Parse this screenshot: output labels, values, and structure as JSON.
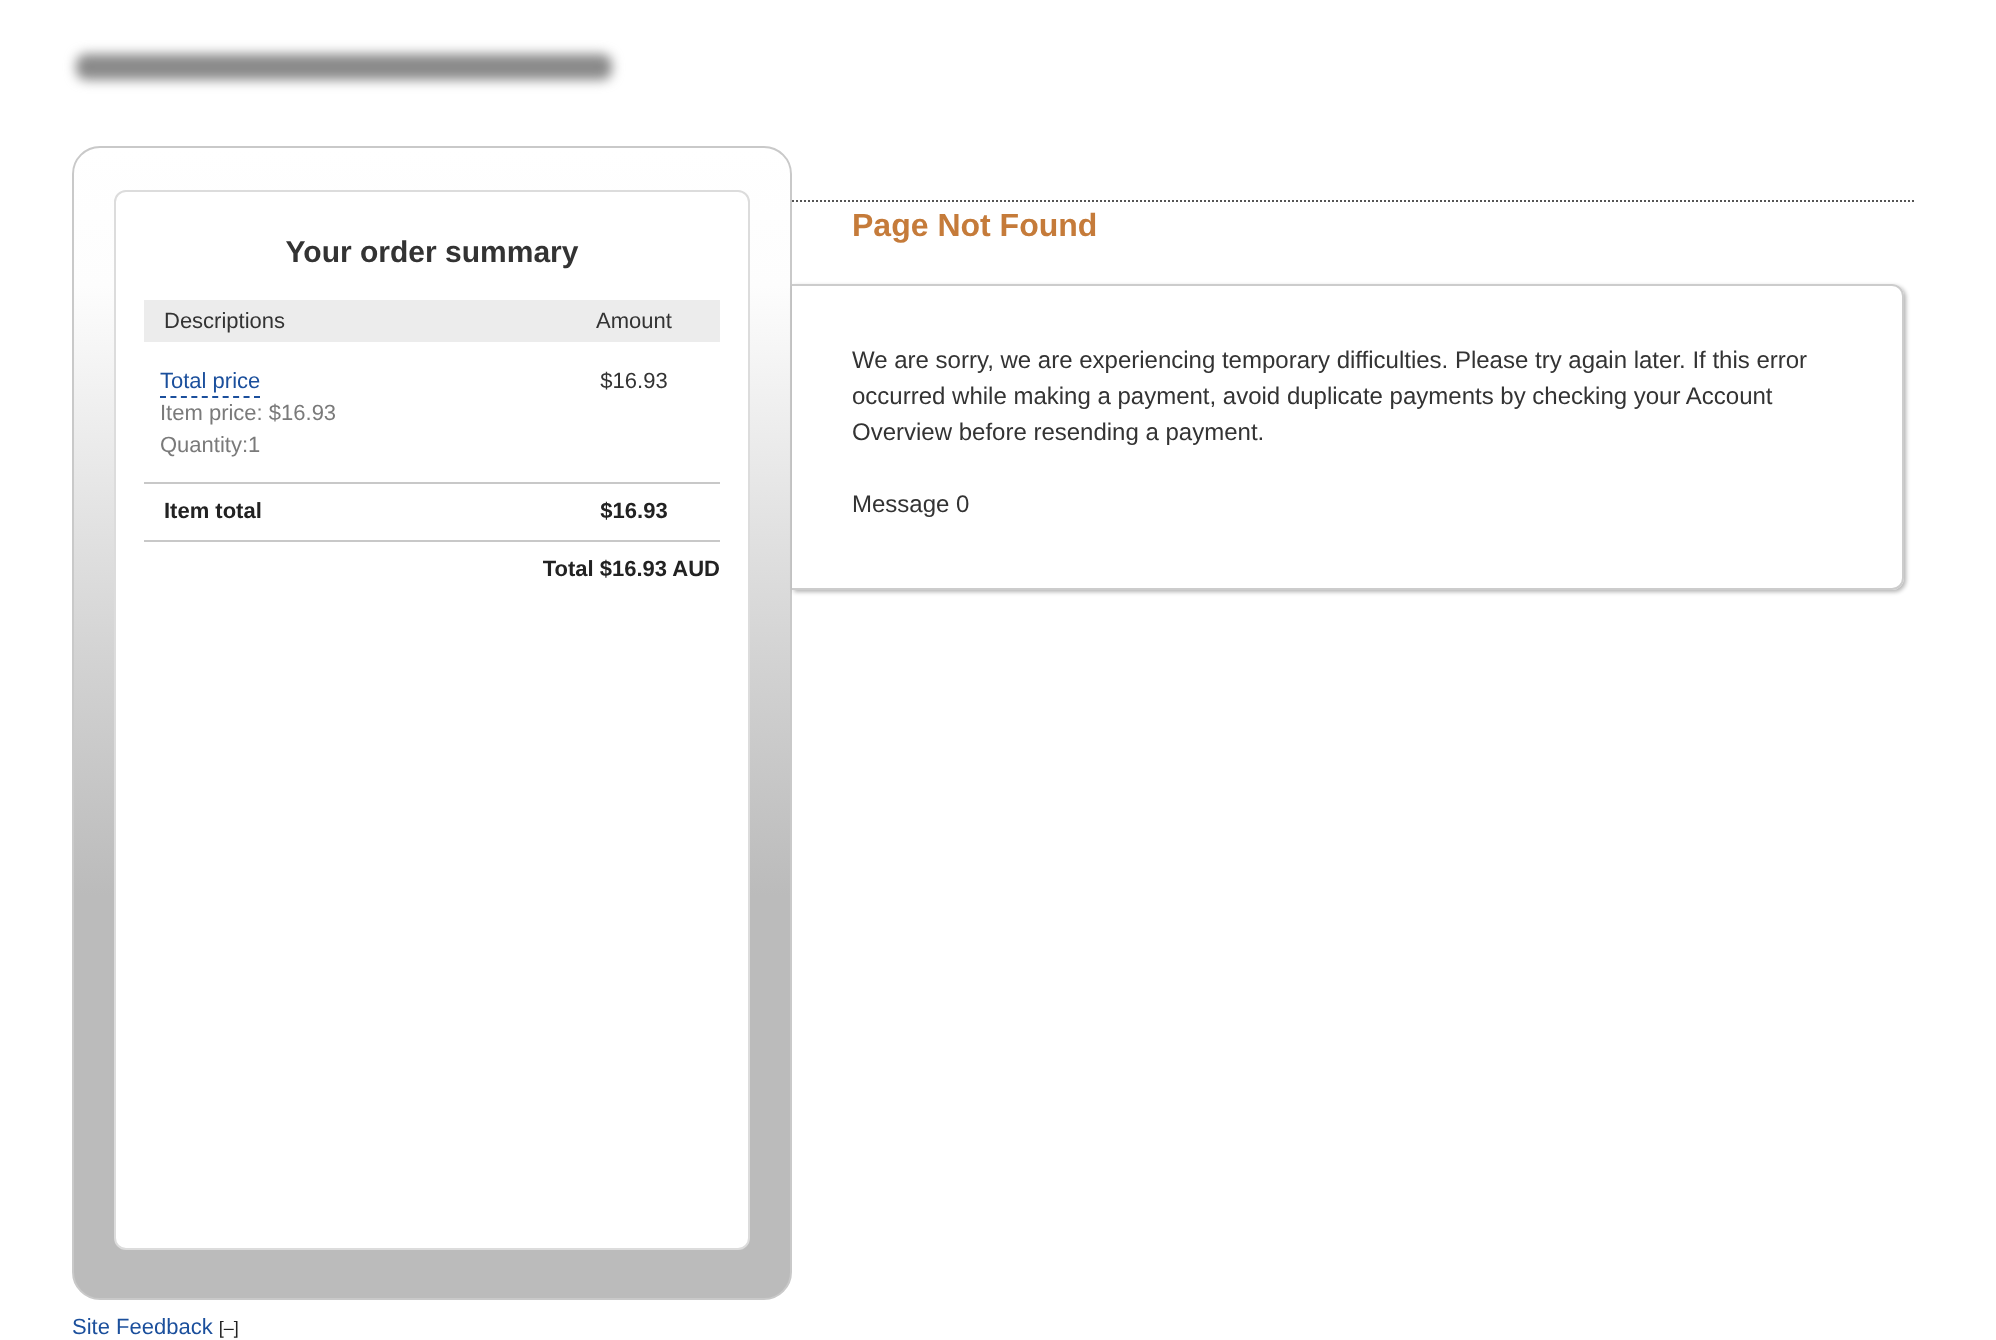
{
  "order_summary": {
    "title": "Your order summary",
    "columns": [
      "Descriptions",
      "Amount"
    ],
    "items": [
      {
        "name": "Total price",
        "details": [
          "Item price: $16.93",
          "Quantity:1"
        ],
        "amount": "$16.93"
      }
    ],
    "item_total": {
      "label": "Item total",
      "amount": "$16.93"
    },
    "total": "Total $16.93 AUD"
  },
  "error": {
    "title": "Page Not Found",
    "paragraphs": [
      "We are sorry, we are experiencing temporary difficulties. Please try again later. If this error occurred while making a payment, avoid duplicate payments by checking your Account Overview before resending a payment.",
      "Message 0"
    ]
  },
  "footer": {
    "link": "Site Feedback",
    "toggle": "[–]"
  }
}
